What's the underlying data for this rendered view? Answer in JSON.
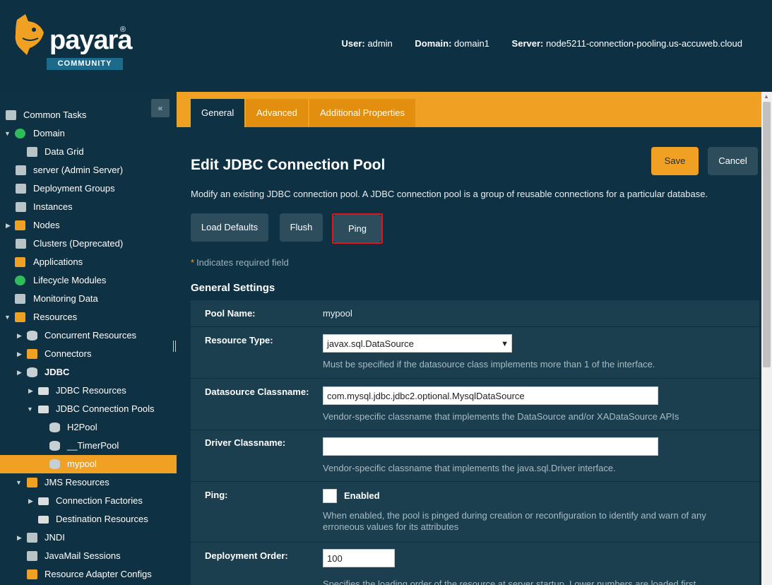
{
  "header": {
    "logo_text": "payara",
    "logo_reg": "®",
    "logo_badge": "COMMUNITY",
    "user_label": "User:",
    "user_value": "admin",
    "domain_label": "Domain:",
    "domain_value": "domain1",
    "server_label": "Server:",
    "server_value": "node5211-connection-pooling.us-accuweb.cloud"
  },
  "sidebar": {
    "collapse_icon": "«",
    "items": [
      {
        "label": "Common Tasks"
      },
      {
        "label": "Domain"
      },
      {
        "label": "Data Grid"
      },
      {
        "label": "server (Admin Server)"
      },
      {
        "label": "Deployment Groups"
      },
      {
        "label": "Instances"
      },
      {
        "label": "Nodes"
      },
      {
        "label": "Clusters (Deprecated)"
      },
      {
        "label": "Applications"
      },
      {
        "label": "Lifecycle Modules"
      },
      {
        "label": "Monitoring Data"
      },
      {
        "label": "Resources"
      },
      {
        "label": "Concurrent Resources"
      },
      {
        "label": "Connectors"
      },
      {
        "label": "JDBC"
      },
      {
        "label": "JDBC Resources"
      },
      {
        "label": "JDBC Connection Pools"
      },
      {
        "label": "H2Pool"
      },
      {
        "label": "__TimerPool"
      },
      {
        "label": "mypool"
      },
      {
        "label": "JMS Resources"
      },
      {
        "label": "Connection Factories"
      },
      {
        "label": "Destination Resources"
      },
      {
        "label": "JNDI"
      },
      {
        "label": "JavaMail Sessions"
      },
      {
        "label": "Resource Adapter Configs"
      }
    ]
  },
  "tabs": [
    {
      "label": "General"
    },
    {
      "label": "Advanced"
    },
    {
      "label": "Additional Properties"
    }
  ],
  "page": {
    "title": "Edit JDBC Connection Pool",
    "description": "Modify an existing JDBC connection pool. A JDBC connection pool is a group of reusable connections for a particular database.",
    "save_label": "Save",
    "cancel_label": "Cancel",
    "load_defaults_label": "Load Defaults",
    "flush_label": "Flush",
    "ping_label": "Ping",
    "required_star": "*",
    "required_note": "Indicates required field",
    "section_title": "General Settings"
  },
  "form": {
    "pool_name_label": "Pool Name:",
    "pool_name_value": "mypool",
    "resource_type_label": "Resource Type:",
    "resource_type_value": "javax.sql.DataSource",
    "resource_type_help": "Must be specified if the datasource class implements more than 1 of the interface.",
    "datasource_label": "Datasource Classname:",
    "datasource_value": "com.mysql.jdbc.jdbc2.optional.MysqlDataSource",
    "datasource_help": "Vendor-specific classname that implements the DataSource and/or XADataSource APIs",
    "driver_label": "Driver Classname:",
    "driver_value": "",
    "driver_help": "Vendor-specific classname that implements the java.sql.Driver interface.",
    "ping_label": "Ping:",
    "ping_checkbox_label": "Enabled",
    "ping_help_1": "When enabled, the pool is pinged during creation or reconfiguration to identify and warn of any",
    "ping_help_2": "erroneous values for its attributes",
    "deploy_order_label": "Deployment Order:",
    "deploy_order_value": "100",
    "deploy_order_help": "Specifies the loading order of the resource at server startup. Lower numbers are loaded first."
  }
}
